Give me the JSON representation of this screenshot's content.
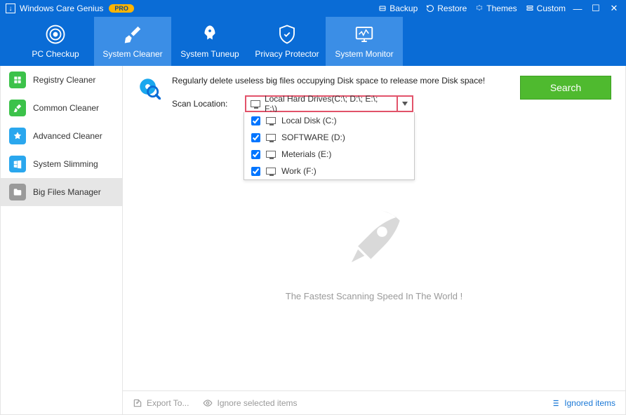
{
  "titlebar": {
    "app_name": "Windows Care Genius",
    "badge": "PRO",
    "links": {
      "backup": "Backup",
      "restore": "Restore",
      "themes": "Themes",
      "custom": "Custom"
    }
  },
  "nav": {
    "pc_checkup": "PC Checkup",
    "system_cleaner": "System Cleaner",
    "system_tuneup": "System Tuneup",
    "privacy_protector": "Privacy Protector",
    "system_monitor": "System Monitor"
  },
  "sidebar": {
    "registry_cleaner": "Registry Cleaner",
    "common_cleaner": "Common Cleaner",
    "advanced_cleaner": "Advanced Cleaner",
    "system_slimming": "System Slimming",
    "big_files_manager": "Big Files Manager"
  },
  "main": {
    "description": "Regularly delete useless big files occupying Disk space to release more Disk space!",
    "scan_location_label": "Scan Location:",
    "dropdown_value": "Local Hard Drives(C:\\; D:\\; E:\\; F:\\)",
    "options": {
      "c": "Local Disk (C:)",
      "d": "SOFTWARE (D:)",
      "e": "Meterials (E:)",
      "f": "Work (F:)"
    },
    "search_button": "Search",
    "tagline": "The Fastest Scanning Speed In The World !"
  },
  "footer": {
    "export": "Export To...",
    "ignore_selected": "Ignore selected items",
    "ignored_items": "Ignored items"
  },
  "colors": {
    "primary": "#0a6cd6",
    "primary_light": "#3b8ee6",
    "accent_green": "#4fba2f",
    "highlight_border": "#e2536a"
  }
}
